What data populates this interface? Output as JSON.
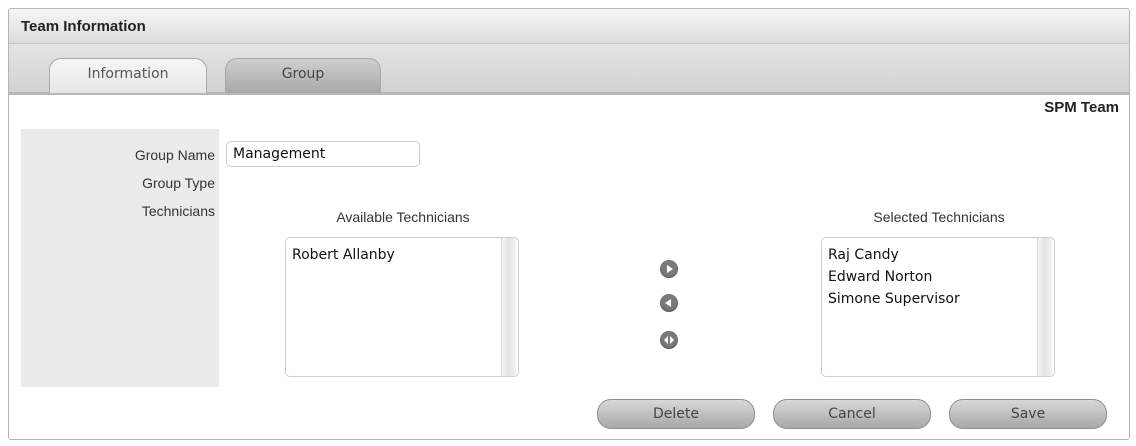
{
  "panel": {
    "title": "Team Information"
  },
  "tabs": [
    {
      "label": "Information"
    },
    {
      "label": "Group"
    }
  ],
  "team": {
    "name": "SPM Team"
  },
  "form": {
    "group_name_label": "Group Name",
    "group_name_value": "Management",
    "group_type_label": "Group Type",
    "technicians_label": "Technicians"
  },
  "available": {
    "title": "Available Technicians",
    "items": [
      "Robert Allanby"
    ]
  },
  "selected": {
    "title": "Selected Technicians",
    "items": [
      "Raj Candy",
      "Edward Norton",
      "Simone Supervisor"
    ]
  },
  "actions": {
    "delete_label": "Delete",
    "cancel_label": "Cancel",
    "save_label": "Save"
  },
  "icons": {
    "move_right": "arrow-right-circle-icon",
    "move_left": "arrow-left-circle-icon",
    "move_both": "arrow-both-circle-icon"
  }
}
